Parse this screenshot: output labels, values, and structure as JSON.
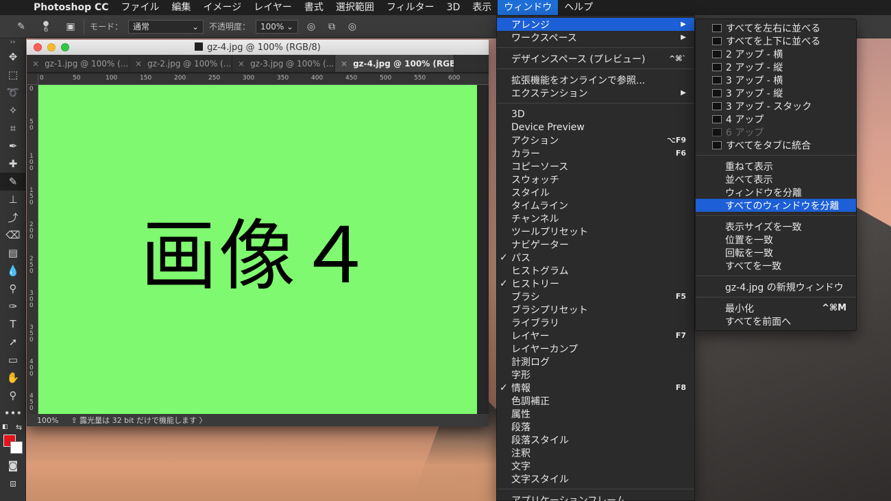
{
  "menubar": {
    "app_name": "Photoshop CC",
    "items": [
      "ファイル",
      "編集",
      "イメージ",
      "レイヤー",
      "書式",
      "選択範囲",
      "フィルター",
      "3D",
      "表示",
      "ウィンドウ",
      "ヘルプ"
    ]
  },
  "options": {
    "brush_size": "6",
    "mode_label": "モード：",
    "mode_value": "通常",
    "opacity_label": "不透明度：",
    "opacity_value": "100%"
  },
  "document": {
    "title": "gz-4.jpg @ 100% (RGB/8)",
    "tabs": [
      {
        "label": "gz-1.jpg @ 100% (..."
      },
      {
        "label": "gz-2.jpg @ 100% (..."
      },
      {
        "label": "gz-3.jpg @ 100% (..."
      },
      {
        "label": "gz-4.jpg @ 100% (RGB/8)"
      }
    ],
    "canvas_text": "画像４",
    "canvas_color": "#7ff96f",
    "status_zoom": "100%",
    "status_info": "露光量は 32 bit だけで機能します",
    "ruler_h_ticks": [
      "0",
      "50",
      "100",
      "150",
      "200",
      "250",
      "300",
      "350",
      "400",
      "450",
      "500",
      "550",
      "600"
    ],
    "ruler_v_ticks": [
      "0",
      "50",
      "100",
      "150",
      "200",
      "250",
      "300",
      "350",
      "400",
      "450"
    ]
  },
  "window_menu": {
    "items": [
      {
        "label": "アレンジ",
        "arrow": "▶"
      },
      {
        "label": "ワークスペース",
        "arrow": "▶"
      },
      {
        "label": "デザインスペース (プレビュー)",
        "shortcut": "^⌘`"
      },
      {
        "label": "拡張機能をオンラインで参照..."
      },
      {
        "label": "エクステンション",
        "arrow": "▶"
      },
      {
        "label": "3D"
      },
      {
        "label": "Device Preview"
      },
      {
        "label": "アクション",
        "shortcut": "⌥F9"
      },
      {
        "label": "カラー",
        "shortcut": "F6"
      },
      {
        "label": "コピーソース"
      },
      {
        "label": "スウォッチ"
      },
      {
        "label": "スタイル"
      },
      {
        "label": "タイムライン"
      },
      {
        "label": "チャンネル"
      },
      {
        "label": "ツールプリセット"
      },
      {
        "label": "ナビゲーター"
      },
      {
        "label": "パス",
        "check": "✓"
      },
      {
        "label": "ヒストグラム"
      },
      {
        "label": "ヒストリー",
        "check": "✓"
      },
      {
        "label": "ブラシ",
        "shortcut": "F5"
      },
      {
        "label": "ブラシプリセット"
      },
      {
        "label": "ライブラリ"
      },
      {
        "label": "レイヤー",
        "shortcut": "F7"
      },
      {
        "label": "レイヤーカンプ"
      },
      {
        "label": "計測ログ"
      },
      {
        "label": "字形"
      },
      {
        "label": "情報",
        "check": "✓",
        "shortcut": "F8"
      },
      {
        "label": "色調補正"
      },
      {
        "label": "属性"
      },
      {
        "label": "段落"
      },
      {
        "label": "段落スタイル"
      },
      {
        "label": "注釈"
      },
      {
        "label": "文字"
      },
      {
        "label": "文字スタイル"
      },
      {
        "label": "アプリケーションフレーム"
      }
    ]
  },
  "arrange_menu": {
    "items": [
      {
        "label": "すべてを左右に並べる"
      },
      {
        "label": "すべてを上下に並べる"
      },
      {
        "label": "2 アップ - 横"
      },
      {
        "label": "2 アップ - 縦"
      },
      {
        "label": "3 アップ - 横"
      },
      {
        "label": "3 アップ - 縦"
      },
      {
        "label": "3 アップ - スタック"
      },
      {
        "label": "4 アップ"
      },
      {
        "label": "6 アップ"
      },
      {
        "label": "すべてをタブに統合"
      },
      {
        "label": "重ねて表示"
      },
      {
        "label": "並べて表示"
      },
      {
        "label": "ウィンドウを分離"
      },
      {
        "label": "すべてのウィンドウを分離"
      },
      {
        "label": "表示サイズを一致"
      },
      {
        "label": "位置を一致"
      },
      {
        "label": "回転を一致"
      },
      {
        "label": "すべてを一致"
      },
      {
        "label": "gz-4.jpg の新規ウィンドウ"
      },
      {
        "label": "最小化",
        "shortcut": "^⌘M"
      },
      {
        "label": "すべてを前面へ"
      }
    ]
  },
  "colors": {
    "foreground": "#e0151b",
    "background": "#ffffff",
    "menu_highlight": "#1c5fd6"
  }
}
